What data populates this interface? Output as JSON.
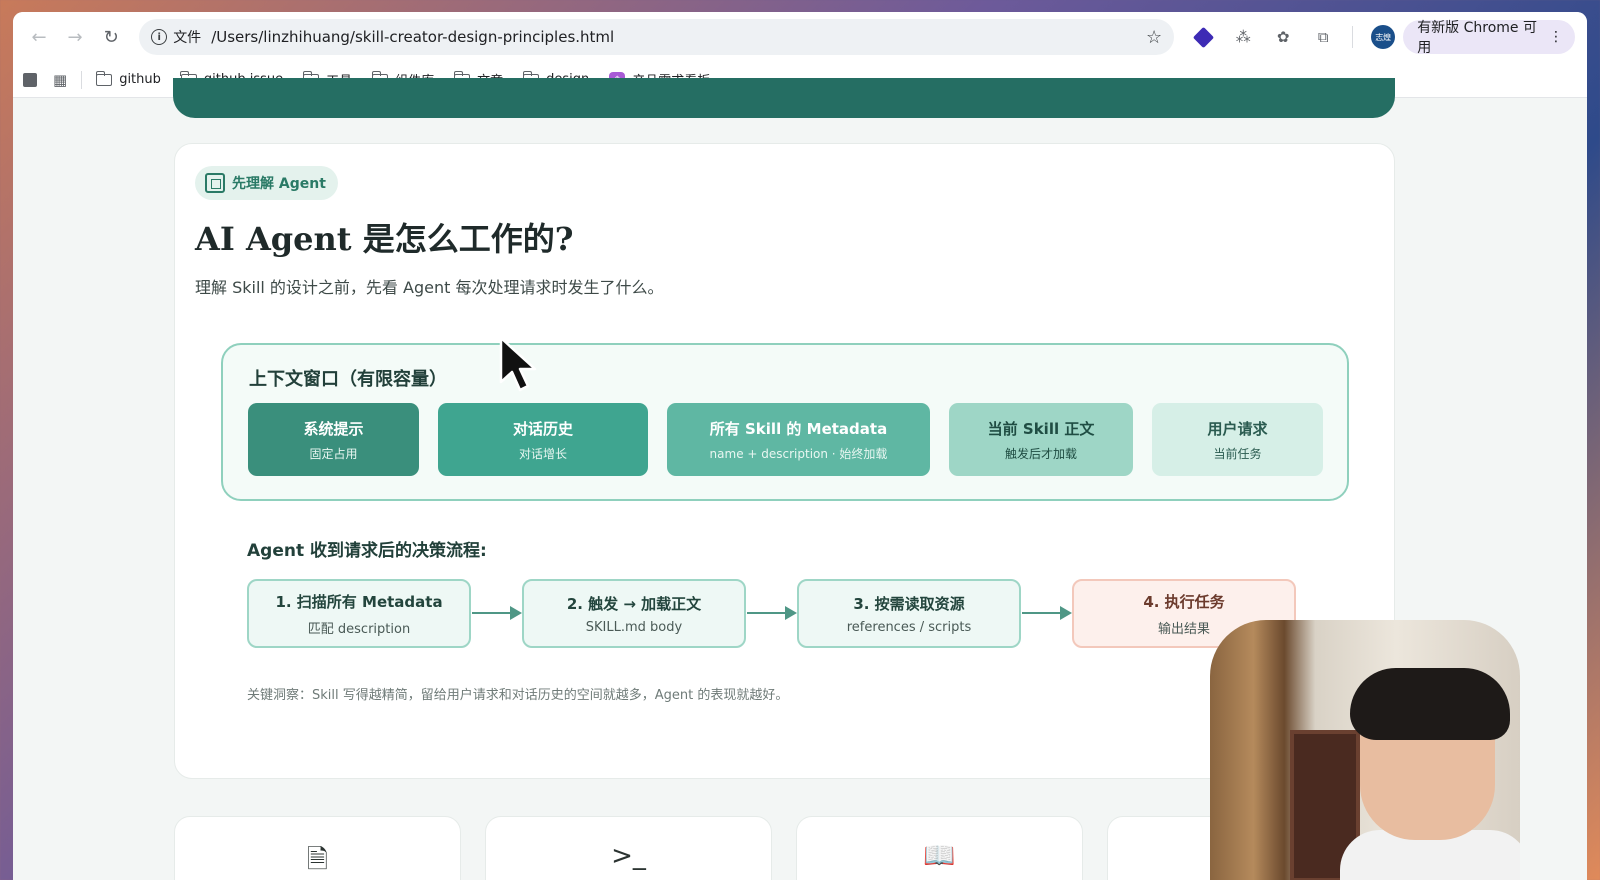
{
  "browser": {
    "back_label": "←",
    "forward_label": "→",
    "reload_label": "↻",
    "security_label": "文件",
    "url": "/Users/linzhihuang/skill-creator-design-principles.html",
    "star": "☆",
    "profile_label": "志煌",
    "update_label": "有新版 Chrome 可用",
    "menu_label": "⋮"
  },
  "bookmarks": [
    {
      "label": "github",
      "icon": "folder-icon"
    },
    {
      "label": "github issue",
      "icon": "folder-icon"
    },
    {
      "label": "工具",
      "icon": "folder-icon"
    },
    {
      "label": "组件库",
      "icon": "folder-icon"
    },
    {
      "label": "文章",
      "icon": "folder-icon"
    },
    {
      "label": "design",
      "icon": "folder-icon"
    },
    {
      "label": "产品需求看板",
      "icon": "app-icon"
    }
  ],
  "card": {
    "badge": "先理解 Agent",
    "title": "AI Agent 是怎么工作的?",
    "subtitle": "理解 Skill 的设计之前，先看 Agent 每次处理请求时发生了什么。",
    "context": {
      "title": "上下文窗口（有限容量）",
      "segments": [
        {
          "title": "系统提示",
          "sub": "固定占用"
        },
        {
          "title": "对话历史",
          "sub": "对话增长"
        },
        {
          "title": "所有 Skill 的 Metadata",
          "sub": "name + description · 始终加载"
        },
        {
          "title": "当前 Skill 正文",
          "sub": "触发后才加载"
        },
        {
          "title": "用户请求",
          "sub": "当前任务"
        }
      ]
    },
    "flow": {
      "title": "Agent 收到请求后的决策流程:",
      "steps": [
        {
          "title": "1. 扫描所有 Metadata",
          "sub": "匹配 description"
        },
        {
          "title": "2. 触发 → 加载正文",
          "sub": "SKILL.md body"
        },
        {
          "title": "3. 按需读取资源",
          "sub": "references / scripts"
        },
        {
          "title": "4. 执行任务",
          "sub": "输出结果"
        }
      ]
    },
    "insight": "关键洞察：Skill 写得越精简，留给用户请求和对话历史的空间就越多，Agent 的表现就越好。"
  },
  "bottom_cards": [
    {
      "icon": "document-icon",
      "glyph": "🗎"
    },
    {
      "icon": "terminal-icon",
      "glyph": ">_"
    },
    {
      "icon": "book-icon",
      "glyph": "📖"
    }
  ],
  "colors": {
    "accent": "#3a8f7c",
    "hero": "#256e63",
    "step_final_bg": "#fdf0ec"
  }
}
